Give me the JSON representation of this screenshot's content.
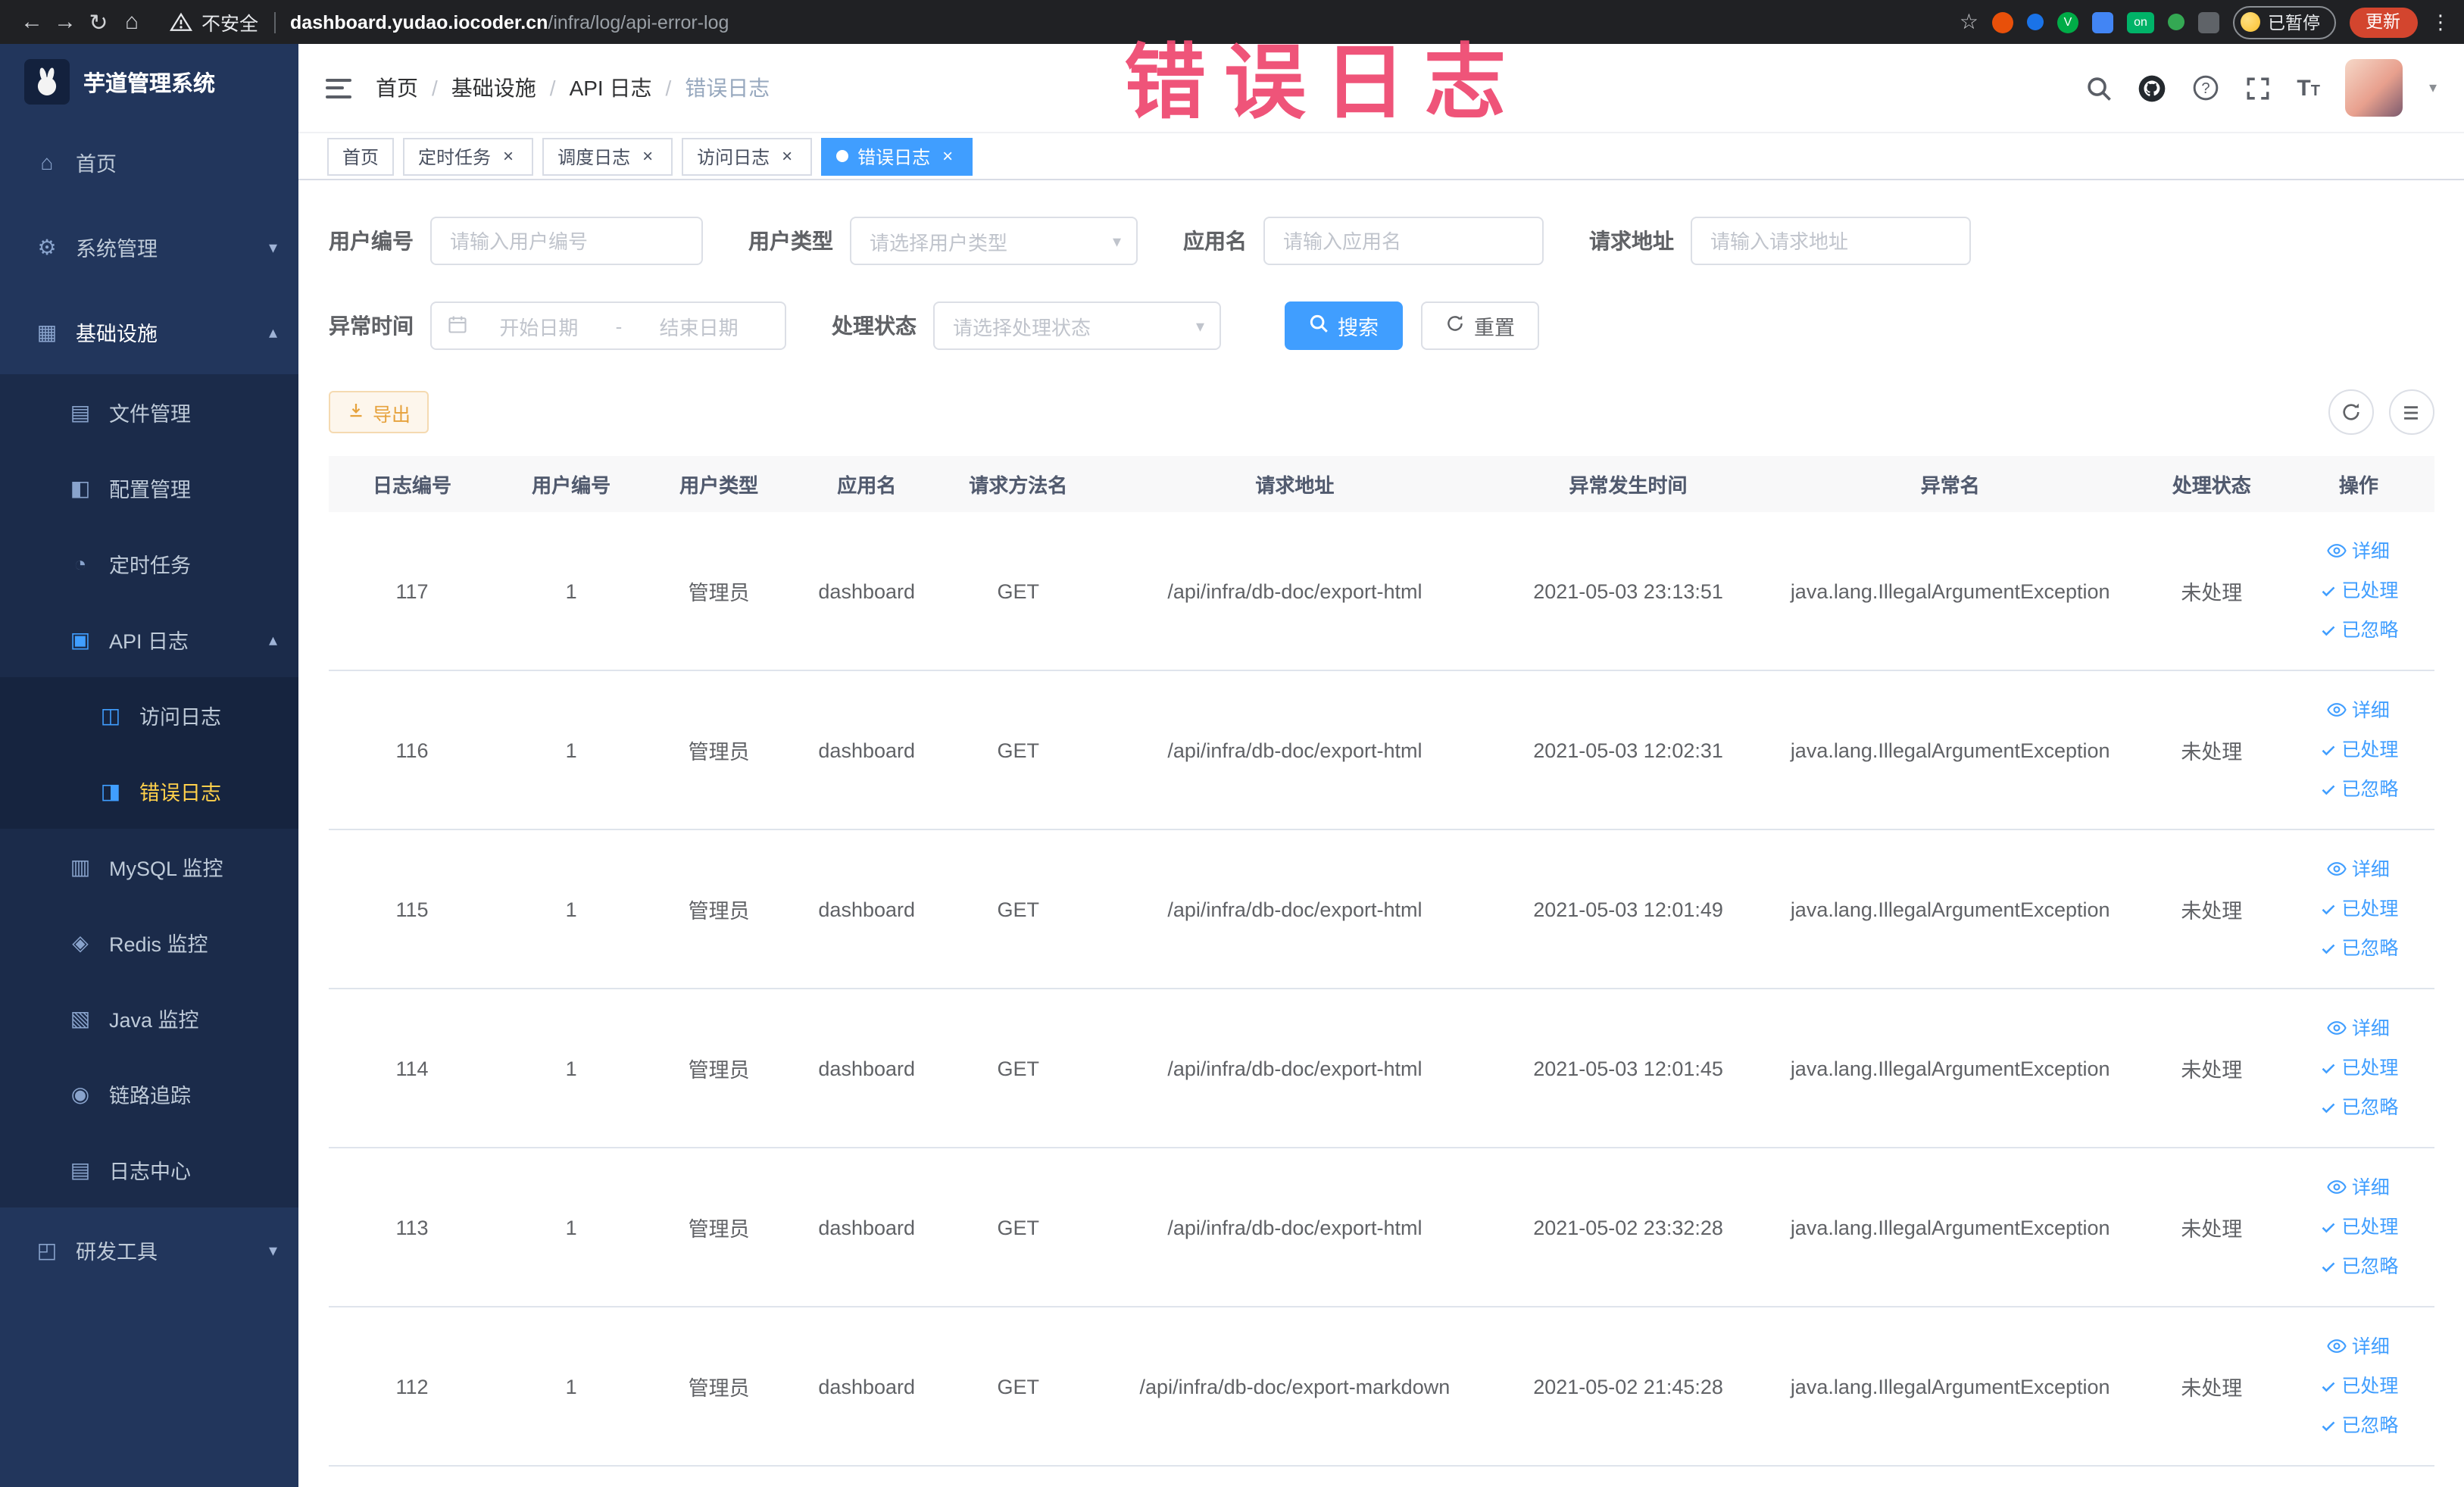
{
  "watermark": "错误日志",
  "browser": {
    "security_label": "不安全",
    "url_host": "dashboard.yudao.iocoder.cn",
    "url_path": "/infra/log/api-error-log",
    "profile_label": "已暂停",
    "update_label": "更新",
    "extension_on_label": "on"
  },
  "icons": {
    "back": "←",
    "forward": "→",
    "reload": "↻",
    "home": "⌂",
    "star": "☆",
    "kebab": "⋮",
    "caret_down": "▾",
    "caret_up": "▴",
    "close": "×",
    "menu_home": "⌂",
    "menu_system": "⚙",
    "menu_infra": "▦",
    "menu_file": "▤",
    "menu_config": "◧",
    "menu_job": "◔",
    "menu_api": "▣",
    "menu_access": "◫",
    "menu_error": "◨",
    "menu_mysql": "▥",
    "menu_redis": "◈",
    "menu_java": "▧",
    "menu_trace": "◉",
    "menu_logcenter": "▤",
    "menu_dev": "◰"
  },
  "sidebar": {
    "logo_title": "芋道管理系统",
    "items": {
      "home": "首页",
      "system": "系统管理",
      "infra": "基础设施",
      "file": "文件管理",
      "config": "配置管理",
      "job": "定时任务",
      "api_log": "API 日志",
      "access_log": "访问日志",
      "error_log": "错误日志",
      "mysql": "MySQL 监控",
      "redis": "Redis 监控",
      "java": "Java 监控",
      "trace": "链路追踪",
      "log_center": "日志中心",
      "dev_tools": "研发工具"
    }
  },
  "breadcrumb": [
    "首页",
    "基础设施",
    "API 日志",
    "错误日志"
  ],
  "tabs": [
    {
      "label": "首页"
    },
    {
      "label": "定时任务"
    },
    {
      "label": "调度日志"
    },
    {
      "label": "访问日志"
    },
    {
      "label": "错误日志"
    }
  ],
  "filters": {
    "user_id_label": "用户编号",
    "user_id_placeholder": "请输入用户编号",
    "user_type_label": "用户类型",
    "user_type_placeholder": "请选择用户类型",
    "app_name_label": "应用名",
    "app_name_placeholder": "请输入应用名",
    "request_url_label": "请求地址",
    "request_url_placeholder": "请输入请求地址",
    "exception_time_label": "异常时间",
    "date_start_placeholder": "开始日期",
    "date_separator": "-",
    "date_end_placeholder": "结束日期",
    "process_status_label": "处理状态",
    "process_status_placeholder": "请选择处理状态",
    "search_button": "搜索",
    "reset_button": "重置"
  },
  "toolbar": {
    "export_label": "导出"
  },
  "table": {
    "headers": [
      "日志编号",
      "用户编号",
      "用户类型",
      "应用名",
      "请求方法名",
      "请求地址",
      "异常发生时间",
      "异常名",
      "处理状态",
      "操作"
    ],
    "actions": {
      "detail": "详细",
      "processed": "已处理",
      "ignored": "已忽略"
    },
    "rows": [
      {
        "id": "117",
        "user_id": "1",
        "user_type": "管理员",
        "app": "dashboard",
        "method": "GET",
        "url": "/api/infra/db-doc/export-html",
        "time": "2021-05-03 23:13:51",
        "exception": "java.lang.IllegalArgumentException",
        "status": "未处理"
      },
      {
        "id": "116",
        "user_id": "1",
        "user_type": "管理员",
        "app": "dashboard",
        "method": "GET",
        "url": "/api/infra/db-doc/export-html",
        "time": "2021-05-03 12:02:31",
        "exception": "java.lang.IllegalArgumentException",
        "status": "未处理"
      },
      {
        "id": "115",
        "user_id": "1",
        "user_type": "管理员",
        "app": "dashboard",
        "method": "GET",
        "url": "/api/infra/db-doc/export-html",
        "time": "2021-05-03 12:01:49",
        "exception": "java.lang.IllegalArgumentException",
        "status": "未处理"
      },
      {
        "id": "114",
        "user_id": "1",
        "user_type": "管理员",
        "app": "dashboard",
        "method": "GET",
        "url": "/api/infra/db-doc/export-html",
        "time": "2021-05-03 12:01:45",
        "exception": "java.lang.IllegalArgumentException",
        "status": "未处理"
      },
      {
        "id": "113",
        "user_id": "1",
        "user_type": "管理员",
        "app": "dashboard",
        "method": "GET",
        "url": "/api/infra/db-doc/export-html",
        "time": "2021-05-02 23:32:28",
        "exception": "java.lang.IllegalArgumentException",
        "status": "未处理"
      },
      {
        "id": "112",
        "user_id": "1",
        "user_type": "管理员",
        "app": "dashboard",
        "method": "GET",
        "url": "/api/infra/db-doc/export-markdown",
        "time": "2021-05-02 21:45:28",
        "exception": "java.lang.IllegalArgumentException",
        "status": "未处理"
      }
    ]
  },
  "colors": {
    "primary": "#409eff",
    "menu_active": "#ffd04b",
    "warning": "#e6a23c",
    "watermark": "#ef4b72"
  }
}
